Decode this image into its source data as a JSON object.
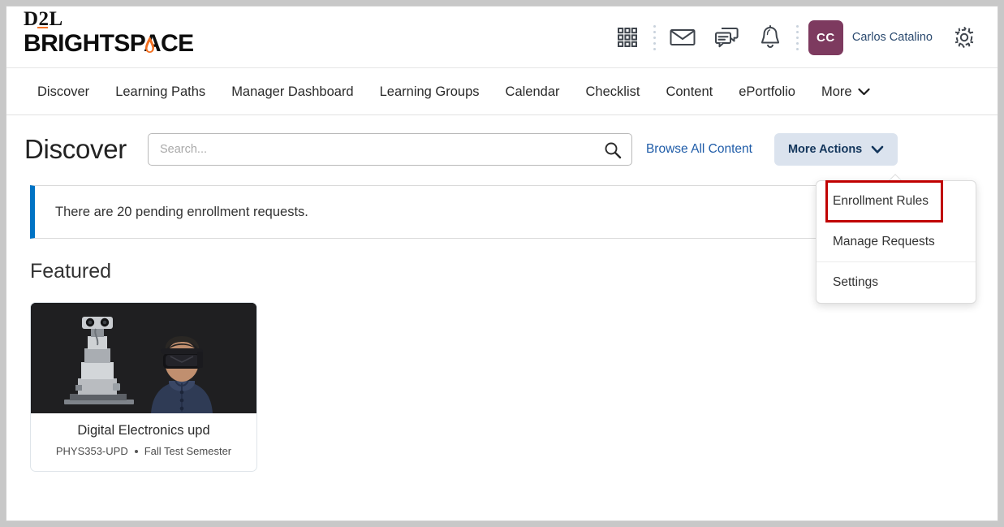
{
  "brand": {
    "logo_top": "D2L",
    "logo_bottom": "BRIGHTSPACE",
    "accent_orange": "#f37021"
  },
  "header": {
    "icons": [
      {
        "name": "waffle-grid-icon",
        "label": "Course Selector"
      },
      {
        "name": "email-icon",
        "label": "Email"
      },
      {
        "name": "chat-icon",
        "label": "Subscription Alerts"
      },
      {
        "name": "bell-icon",
        "label": "Update Alerts"
      },
      {
        "name": "gear-icon",
        "label": "Settings"
      }
    ],
    "avatar_initials": "CC",
    "avatar_color": "#7d3a5f",
    "user_name": "Carlos Catalino"
  },
  "nav": {
    "items": [
      {
        "label": "Discover"
      },
      {
        "label": "Learning Paths"
      },
      {
        "label": "Manager Dashboard"
      },
      {
        "label": "Learning Groups"
      },
      {
        "label": "Calendar"
      },
      {
        "label": "Checklist"
      },
      {
        "label": "Content"
      },
      {
        "label": "ePortfolio"
      }
    ],
    "more_label": "More"
  },
  "page": {
    "title": "Discover"
  },
  "search": {
    "value": "",
    "placeholder": "Search...",
    "icon": "search-icon"
  },
  "actions": {
    "browse_all_label": "Browse All Content",
    "more_actions_label": "More Actions",
    "more_actions_bg": "#dbe3ee",
    "more_actions_fg": "#12355b"
  },
  "dropdown": {
    "items": [
      {
        "label": "Enrollment Rules",
        "highlighted": true
      },
      {
        "label": "Manage Requests",
        "highlighted": false
      },
      {
        "label": "Settings",
        "highlighted": false
      }
    ],
    "highlight_color": "#c00000"
  },
  "banner": {
    "text": "There are 20 pending enrollment requests.",
    "accent_color": "#0073c4"
  },
  "featured": {
    "heading": "Featured",
    "cards": [
      {
        "title": "Digital Electronics upd",
        "code": "PHYS353-UPD",
        "semester": "Fall Test Semester",
        "image_alt": "Person wearing a VR headset beside a camera robot rig"
      }
    ]
  }
}
